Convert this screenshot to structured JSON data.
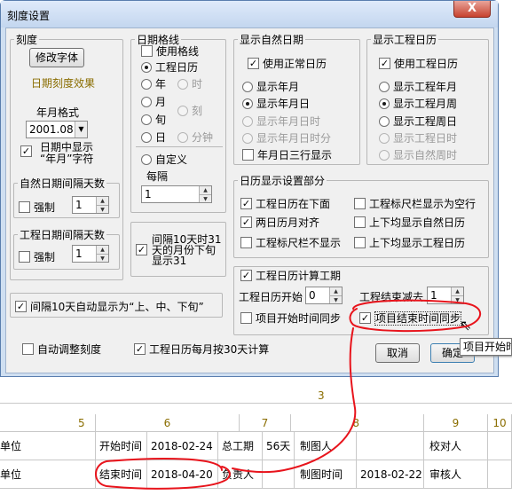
{
  "window": {
    "title": "刻度设置",
    "close_label": "X"
  },
  "scale_group": {
    "legend": "刻度",
    "modify_font_button": "修改字体",
    "effect_label": "日期刻度效果",
    "year_format_label": "年月格式",
    "year_format_value": "2001.08",
    "show_year_month_in_day_line1": "日期中显示",
    "show_year_month_in_day_line2": "“年月”字符",
    "show_year_month_in_day_checked": true
  },
  "natural_interval_group": {
    "legend": "自然日期间隔天数",
    "force_label": "强制",
    "force_checked": false,
    "value": "1"
  },
  "project_interval_group": {
    "legend": "工程日期间隔天数",
    "force_label": "强制",
    "force_checked": false,
    "value": "1"
  },
  "ten_day_checkbox": {
    "label": "间隔10天自动显示为“上、中、下旬”",
    "checked": true
  },
  "auto_adjust_checkbox": {
    "label": "自动调整刻度",
    "checked": false
  },
  "month_30_checkbox": {
    "label": "工程日历每月按30天计算",
    "checked": true
  },
  "grid_group": {
    "legend": "日期格线",
    "use_grid_label": "使用格线",
    "use_grid_checked": false,
    "options": {
      "project_calendar": "工程日历",
      "year": "年",
      "hour": "时",
      "month": "月",
      "quarter_hour": "刻",
      "xun": "旬",
      "minute": "分钟",
      "day": "日",
      "custom": "自定义"
    },
    "interval_label": "每隔",
    "interval_value": "1"
  },
  "month31_checkbox": {
    "label": "间隔10天时31天的月份下旬显示31",
    "line1": "间隔10天时31",
    "line2": "天的月份下旬",
    "line3": "显示31",
    "checked": true
  },
  "natural_date_group": {
    "legend": "显示自然日期",
    "use_normal_label": "使用正常日历",
    "use_normal_checked": true,
    "options": [
      "显示年月",
      "显示年月日",
      "显示年月日时",
      "显示年月日时分",
      "年月日三行显示"
    ]
  },
  "project_date_group": {
    "legend": "显示工程日历",
    "use_project_label": "使用工程日历",
    "use_project_checked": true,
    "options": [
      "显示工程年月",
      "显示工程月周",
      "显示工程周日",
      "显示工程日时",
      "显示自然周时"
    ]
  },
  "calendar_display_group": {
    "legend": "日历显示设置部分",
    "items": [
      {
        "label": "工程日历在下面",
        "checked": true
      },
      {
        "label": "工程标尺栏显示为空行",
        "checked": false
      },
      {
        "label": "两日历月对齐",
        "checked": true
      },
      {
        "label": "上下均显示自然日历",
        "checked": false
      },
      {
        "label": "工程标尺栏不显示",
        "checked": false
      },
      {
        "label": "上下均显示工程日历",
        "checked": false
      }
    ]
  },
  "workday_group": {
    "legend": "工程日历计算工期",
    "legend_checked": true,
    "start_label": "工程日历开始",
    "start_value": "0",
    "end_minus_label": "工程结束减去",
    "end_minus_value": "1",
    "sync_start_label": "项目开始时间同步",
    "sync_start_checked": false,
    "sync_end_label": "项目结束时间同步",
    "sync_end_checked": true
  },
  "buttons": {
    "cancel": "取消",
    "ok": "确定"
  },
  "tooltip": "项目开始时",
  "sheet": {
    "top_number": "3",
    "col_numbers": [
      "5",
      "6",
      "7",
      "8",
      "9",
      "10"
    ],
    "row1": [
      "单位",
      "",
      "开始时间",
      "2018-02-24",
      "总工期",
      "56天",
      "制图人",
      "",
      "",
      "校对人",
      ""
    ],
    "row2": [
      "单位",
      "",
      "结束时间",
      "2018-04-20",
      "负责人",
      "",
      "制图时间",
      "2018-02-22",
      "审核人",
      ""
    ]
  },
  "colors": {
    "accent_red": "#e8141c",
    "title_bg": "#cfdff1",
    "close_red": "#c7422e"
  }
}
